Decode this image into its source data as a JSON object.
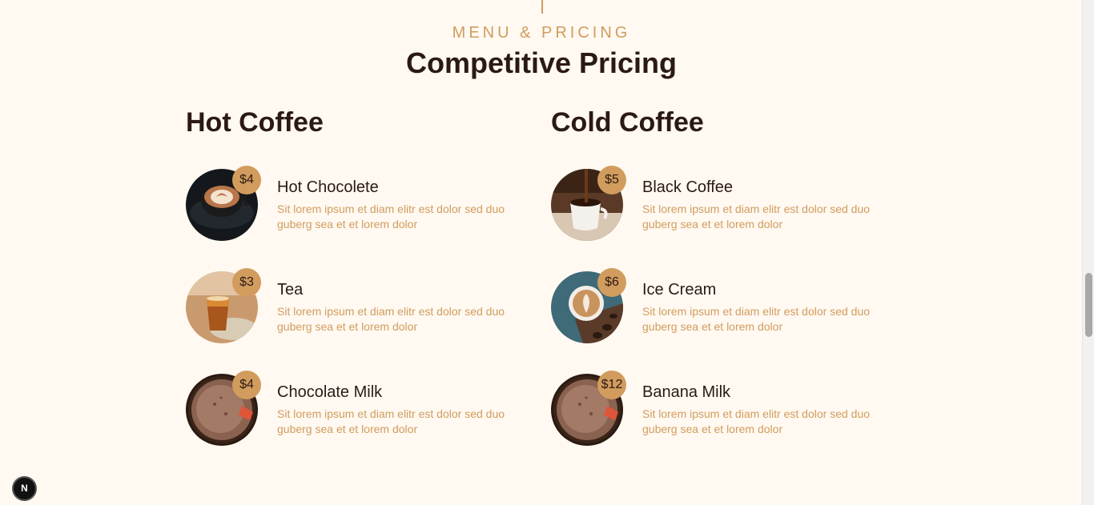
{
  "section": {
    "eyebrow": "Menu & Pricing",
    "title": "Competitive Pricing"
  },
  "colors": {
    "accent": "#d19c5d",
    "heading": "#2b1a14",
    "background": "#fff9f1"
  },
  "hot": {
    "heading": "Hot Coffee",
    "items": [
      {
        "name": "Hot Chocolete",
        "price": "$4",
        "description": "Sit lorem ipsum et diam elitr est dolor sed duo guberg sea et et lorem dolor",
        "image": "latte-art-cup"
      },
      {
        "name": "Tea",
        "price": "$3",
        "description": "Sit lorem ipsum et diam elitr est dolor sed duo guberg sea et et lorem dolor",
        "image": "tea-glass"
      },
      {
        "name": "Chocolate Milk",
        "price": "$4",
        "description": "Sit lorem ipsum et diam elitr est dolor sed duo guberg sea et et lorem dolor",
        "image": "chocolate-milk-cup"
      }
    ]
  },
  "cold": {
    "heading": "Cold Coffee",
    "items": [
      {
        "name": "Black Coffee",
        "price": "$5",
        "description": "Sit lorem ipsum et diam elitr est dolor sed duo guberg sea et et lorem dolor",
        "image": "black-coffee-pour"
      },
      {
        "name": "Ice Cream",
        "price": "$6",
        "description": "Sit lorem ipsum et diam elitr est dolor sed duo guberg sea et et lorem dolor",
        "image": "latte-art-beans"
      },
      {
        "name": "Banana Milk",
        "price": "$12",
        "description": "Sit lorem ipsum et diam elitr est dolor sed duo guberg sea et et lorem dolor",
        "image": "chocolate-milk-cup"
      }
    ]
  },
  "dev_badge": {
    "label": "N",
    "icon": "nextjs-icon"
  }
}
